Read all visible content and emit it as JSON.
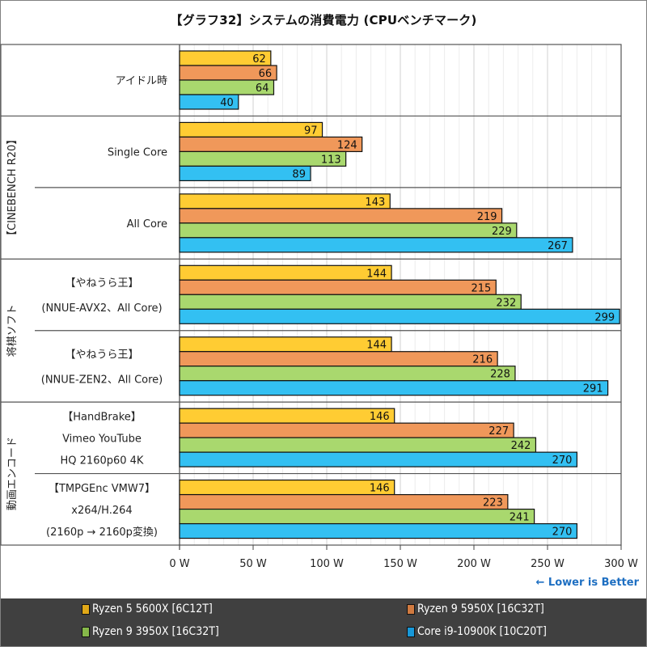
{
  "chart_data": {
    "type": "bar",
    "orientation": "horizontal",
    "title": "【グラフ32】システムの消費電力 (CPUベンチマーク)",
    "xlabel": "",
    "ylabel": "",
    "xlim": [
      0,
      300
    ],
    "x_ticks": [
      "0 W",
      "50 W",
      "100 W",
      "150 W",
      "200 W",
      "250 W",
      "300 W"
    ],
    "x_tick_values": [
      0,
      50,
      100,
      150,
      200,
      250,
      300
    ],
    "minor_grid_step": 10,
    "grid": true,
    "annotation": "← Lower is Better",
    "legend_position": "bottom",
    "groups": [
      {
        "name": "",
        "categories": [
          0
        ]
      },
      {
        "name": "【CINEBENCH R20】",
        "categories": [
          1,
          2
        ]
      },
      {
        "name": "将棋ソフト",
        "categories": [
          3,
          4
        ]
      },
      {
        "name": "動画エンコード",
        "categories": [
          5,
          6
        ]
      }
    ],
    "categories": [
      {
        "lines": [
          "アイドル時"
        ]
      },
      {
        "lines": [
          "Single Core"
        ]
      },
      {
        "lines": [
          "All Core"
        ]
      },
      {
        "lines": [
          "【やねうら王】",
          "(NNUE-AVX2、All Core)"
        ]
      },
      {
        "lines": [
          "【やねうら王】",
          "(NNUE-ZEN2、All Core)"
        ]
      },
      {
        "lines": [
          "【HandBrake】",
          "Vimeo YouTube",
          "HQ 2160p60 4K"
        ]
      },
      {
        "lines": [
          "【TMPGEnc VMW7】",
          "x264/H.264",
          "(2160p → 2160p変換)"
        ]
      }
    ],
    "series": [
      {
        "name": "Ryzen 5 5600X [6C12T]",
        "color": "#ffcc33",
        "legend_color": "#e0a818",
        "values": [
          62,
          97,
          143,
          144,
          144,
          146,
          146
        ]
      },
      {
        "name": "Ryzen 9 5950X [16C32T]",
        "color": "#f0985a",
        "legend_color": "#d07a40",
        "values": [
          66,
          124,
          219,
          215,
          216,
          227,
          223
        ]
      },
      {
        "name": "Ryzen 9 3950X [16C32T]",
        "color": "#a9d86e",
        "legend_color": "#86b84a",
        "values": [
          64,
          113,
          229,
          232,
          228,
          242,
          241
        ]
      },
      {
        "name": "Core i9-10900K [10C20T]",
        "color": "#33c0f2",
        "legend_color": "#1898d8",
        "values": [
          40,
          89,
          267,
          299,
          291,
          270,
          270
        ]
      }
    ]
  },
  "legend": [
    {
      "label": "Ryzen 5 5600X [6C12T]"
    },
    {
      "label": "Ryzen 9 5950X [16C32T]"
    },
    {
      "label": "Ryzen 9 3950X [16C32T]"
    },
    {
      "label": "Core i9-10900K [10C20T]"
    }
  ]
}
